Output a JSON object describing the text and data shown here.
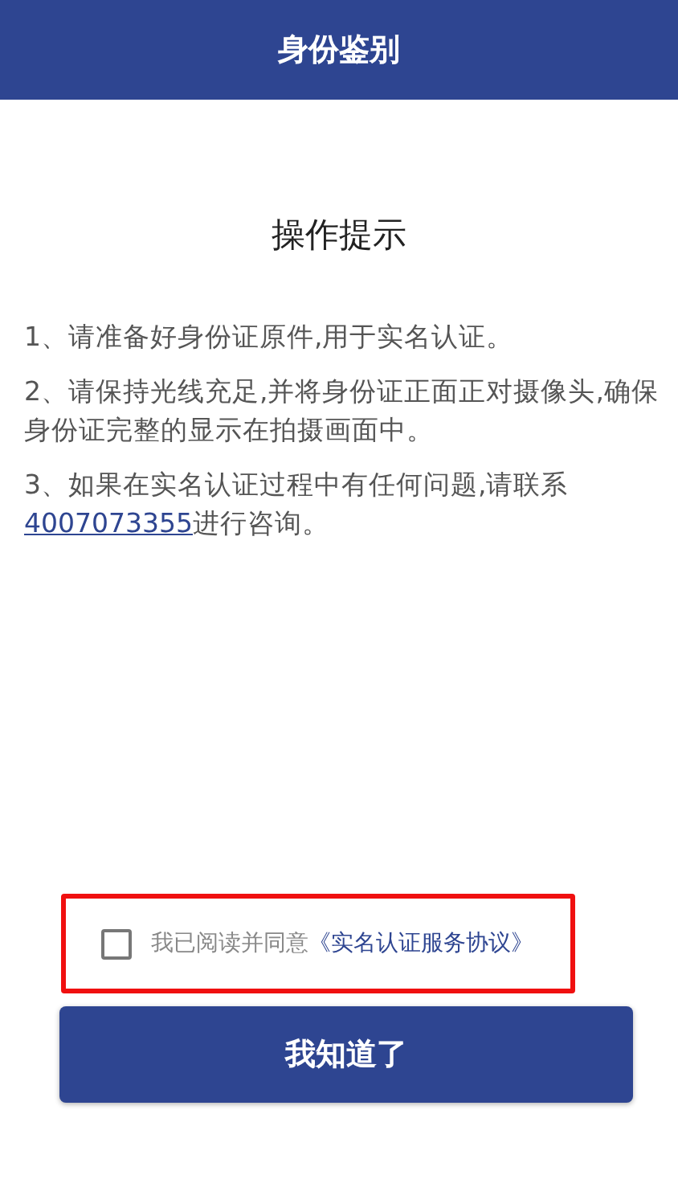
{
  "header": {
    "title": "身份鉴别"
  },
  "heading": "操作提示",
  "instructions": [
    {
      "text": "1、请准备好身份证原件,用于实名认证。"
    },
    {
      "text": "2、请保持光线充足,并将身份证正面正对摄像头,确保身份证完整的显示在拍摄画面中。"
    },
    {
      "text": "3、如果在实名认证过程中有任何问题,请联系",
      "phone": "4007073355",
      "after": "进行咨询。"
    }
  ],
  "agreement": {
    "checked": false,
    "highlighted": true,
    "label": "我已阅读并同意",
    "link": "《实名认证服务协议》"
  },
  "confirm_button": "我知道了"
}
